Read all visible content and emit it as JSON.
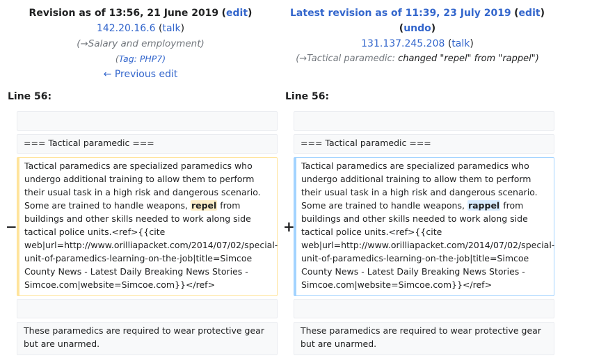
{
  "left_header": {
    "title_prefix": "Revision as of 13:56, 21 June 2019",
    "edit_label": "edit",
    "user": "142.20.16.6",
    "talk_label": "talk",
    "summary": "(→Salary and employment)",
    "tag_open": "(",
    "tag_label": "Tag",
    "tag_value": ": PHP7)",
    "prev_edit": "← Previous edit"
  },
  "right_header": {
    "title_prefix": "Latest revision as of 11:39, 23 July 2019",
    "edit_label": "edit",
    "undo_label": "undo",
    "user": "131.137.245.208",
    "talk_label": "talk",
    "summary_section": "(→Tactical paramedic:",
    "summary_text": "changed \"repel\" from \"rappel\")"
  },
  "line_label": "Line 56:",
  "markers": {
    "minus": "−",
    "plus": "+"
  },
  "diff": {
    "context_heading": "=== Tactical paramedic ===",
    "left_para_before": "Tactical paramedics are specialized paramedics who undergo additional training to allow them to perform their usual task in a high risk and dangerous scenario. Some are trained to handle weapons, ",
    "left_changed_word": "repel",
    "left_para_after": " from buildings and other skills needed to work along side tactical police units.<ref>{{cite web|url=http://www.orilliapacket.com/2014/07/02/special-unit-of-paramedics-learning-on-the-job|title=Simcoe County News - Latest Daily Breaking News Stories - Simcoe.com|website=Simcoe.com}}</ref>",
    "right_para_before": "Tactical paramedics are specialized paramedics who undergo additional training to allow them to perform their usual task in a high risk and dangerous scenario. Some are trained to handle weapons, ",
    "right_changed_word": "rappel",
    "right_para_after": " from buildings and other skills needed to work along side tactical police units.<ref>{{cite web|url=http://www.orilliapacket.com/2014/07/02/special-unit-of-paramedics-learning-on-the-job|title=Simcoe County News - Latest Daily Breaking News Stories - Simcoe.com|website=Simcoe.com}}</ref>",
    "context_last": "These paramedics are required to wear protective gear but are unarmed."
  }
}
